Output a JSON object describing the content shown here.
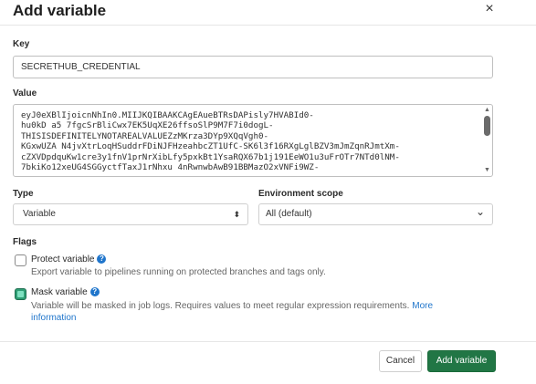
{
  "modal": {
    "title": "Add variable",
    "close_glyph": "×"
  },
  "key": {
    "label": "Key",
    "value": "SECRETHUB_CREDENTIAL"
  },
  "value": {
    "label": "Value",
    "lines": [
      "eyJ0eXBlIjoicnNhIn0.MIIJKQIBAAKCAgEAueBTRsDAPisly7HVABId0-",
      "hu0kD a5 7fgcSrBliCwx7EK5UqXE26ffsoSlP9M7F7i0dogL-",
      "THISISDEFINITELYNOTAREALVALUEZzMKrza3DYp9XQqVgh0-",
      "KGxwUZA N4jvXtrLoqHSuddrFDiNJFHzeahbcZT1UfC-SK6l3f16RXgLglBZV3mJmZqnRJmtXm-",
      "cZXVDpdquKw1cre3y1fnV1prNrXibLfy5pxkBt1YsaRQX67b1j191EeWO1u3uFrOTr7NTd0lNM-",
      "7bkiKo12xeUG4SGGyctfTaxJ1rNhxu 4nRwnwbAwB91BBMazO2xVNFi9WZ-"
    ],
    "scroll_up_glyph": "▲",
    "scroll_down_glyph": "▼"
  },
  "type": {
    "label": "Type",
    "selected": "Variable",
    "arrow_glyph": "⬍"
  },
  "environment": {
    "label": "Environment scope",
    "selected": "All (default)",
    "arrow_glyph": "⌄"
  },
  "flags": {
    "label": "Flags",
    "protect": {
      "label": "Protect variable",
      "checked": false,
      "help": "Export variable to pipelines running on protected branches and tags only."
    },
    "mask": {
      "label": "Mask variable",
      "checked": true,
      "help": "Variable will be masked in job logs. Requires values to meet regular expression requirements.",
      "link_line1": "More",
      "link_line2": "information"
    },
    "help_glyph": "?"
  },
  "footer": {
    "cancel_label": "Cancel",
    "add_label": "Add variable"
  },
  "colors": {
    "primary": "#217645",
    "link": "#1f75cb",
    "checkbox_checked": "#2f9e74"
  }
}
